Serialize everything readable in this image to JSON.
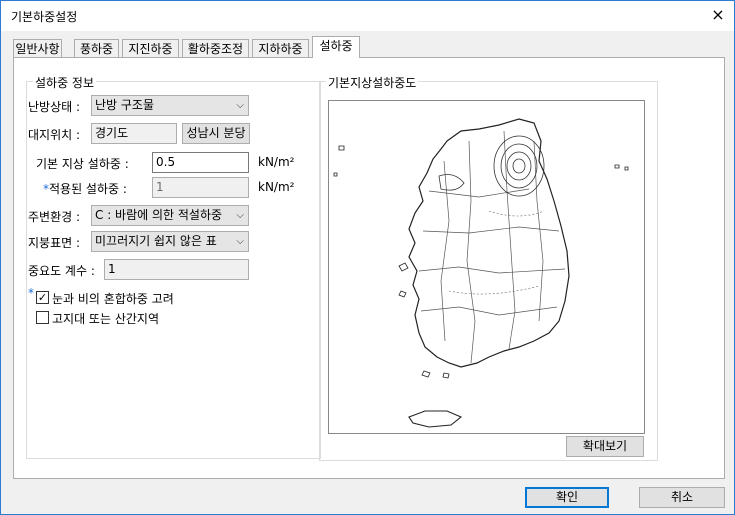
{
  "window": {
    "title": "기본하중설정"
  },
  "tabs": [
    {
      "label": "일반사항"
    },
    {
      "label": "풍하중"
    },
    {
      "label": "지진하중"
    },
    {
      "label": "활하중조정"
    },
    {
      "label": "지하하중"
    },
    {
      "label": "설하중"
    }
  ],
  "snow_info": {
    "legend": "설하중 정보",
    "heating_label": "난방상태 :",
    "heating_value": "난방 구조물",
    "site_label": "대지위치 :",
    "site_province": "경기도",
    "site_city": "성남시 분당",
    "basic_snow_label": "기본 지상 설하중 :",
    "basic_snow_value": "0.5",
    "unit": "kN/m²",
    "applied_snow_label": "적용된 설하중 :",
    "applied_snow_value": "1",
    "surroundings_label": "주변환경 :",
    "surroundings_value": "C : 바람에 의한 적설하중",
    "roof_label": "지붕표면 :",
    "roof_value": "미끄러지기 쉽지 않은 표",
    "importance_label": "중요도 계수 :",
    "importance_value": "1",
    "mix_rain_label": "눈과 비의 혼합하중 고려",
    "mix_rain_checked": true,
    "highland_label": "고지대 또는 산간지역",
    "highland_checked": false,
    "star": "*"
  },
  "map_panel": {
    "legend": "기본지상설하중도",
    "zoom_button": "확대보기"
  },
  "footer": {
    "ok_label": "확인",
    "cancel_label": "취소"
  },
  "icons": {
    "close": "×",
    "dropdown": "⌵",
    "check": "✓"
  }
}
